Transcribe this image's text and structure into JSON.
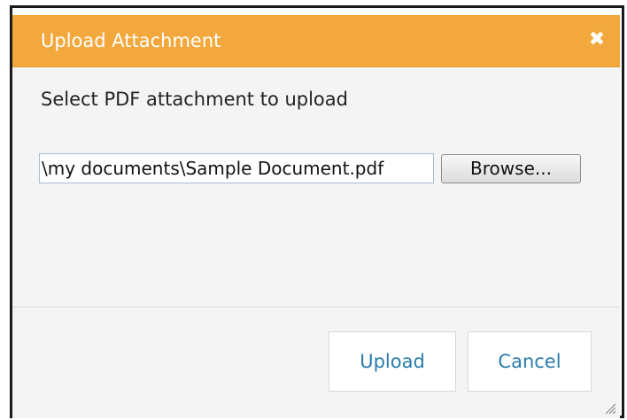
{
  "dialog": {
    "title": "Upload Attachment",
    "close_icon": "close-icon"
  },
  "form": {
    "prompt": "Select PDF attachment to upload",
    "file_value": "\\my documents\\Sample Document.pdf",
    "browse_label": "Browse..."
  },
  "footer": {
    "upload_label": "Upload",
    "cancel_label": "Cancel"
  },
  "colors": {
    "titlebar": "#f2a83c",
    "button_text": "#2a7cab",
    "body_bg": "#f4f4f4"
  },
  "icons": {
    "close": "close-icon",
    "resize": "resize-grip-icon"
  }
}
